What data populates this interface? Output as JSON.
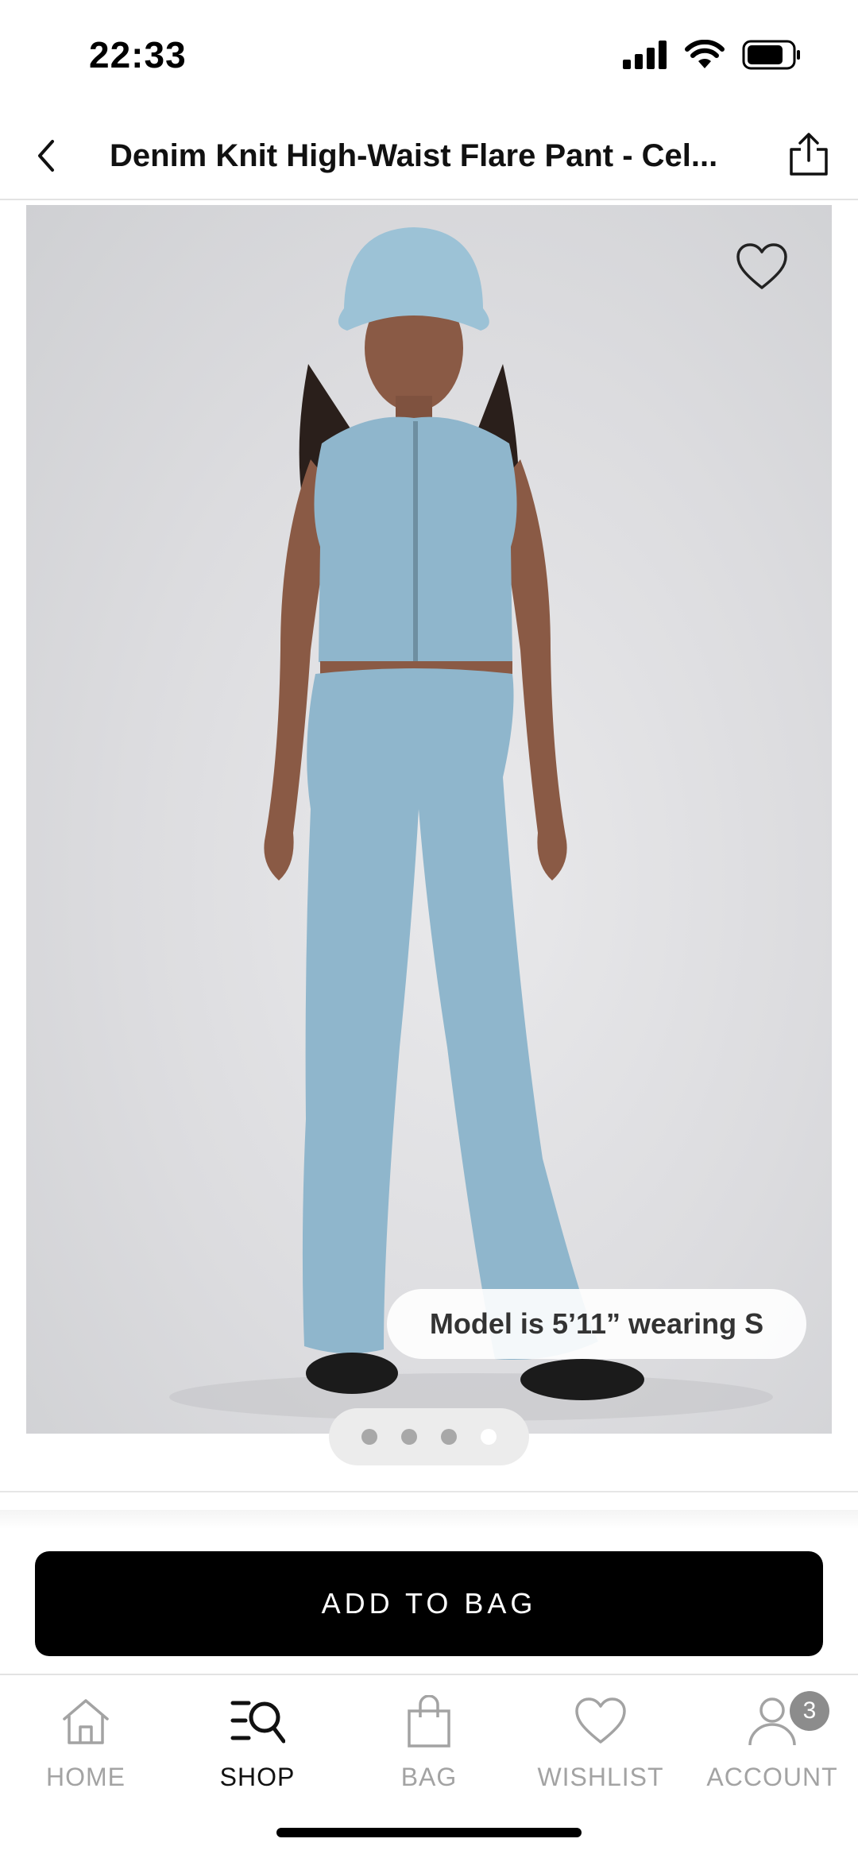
{
  "status_bar": {
    "time": "22:33"
  },
  "header": {
    "title": "Denim Knit High-Waist Flare Pant - Cel..."
  },
  "product": {
    "model_note": "Model is 5’11” wearing S",
    "image_count": 4,
    "active_image_index": 4
  },
  "actions": {
    "add_to_bag_label": "ADD TO BAG"
  },
  "tab_bar": {
    "tabs": [
      {
        "label": "HOME",
        "icon": "home-icon",
        "active": false
      },
      {
        "label": "SHOP",
        "icon": "shop-search-icon",
        "active": true
      },
      {
        "label": "BAG",
        "icon": "bag-icon",
        "active": false
      },
      {
        "label": "WISHLIST",
        "icon": "heart-icon",
        "active": false
      },
      {
        "label": "ACCOUNT",
        "icon": "account-icon",
        "active": false,
        "badge": "3"
      }
    ]
  },
  "colors": {
    "accent": "#000000",
    "inactive_tab": "#a3a3a3",
    "badge": "#8c8c8c",
    "garment": "#8fb6cc"
  }
}
